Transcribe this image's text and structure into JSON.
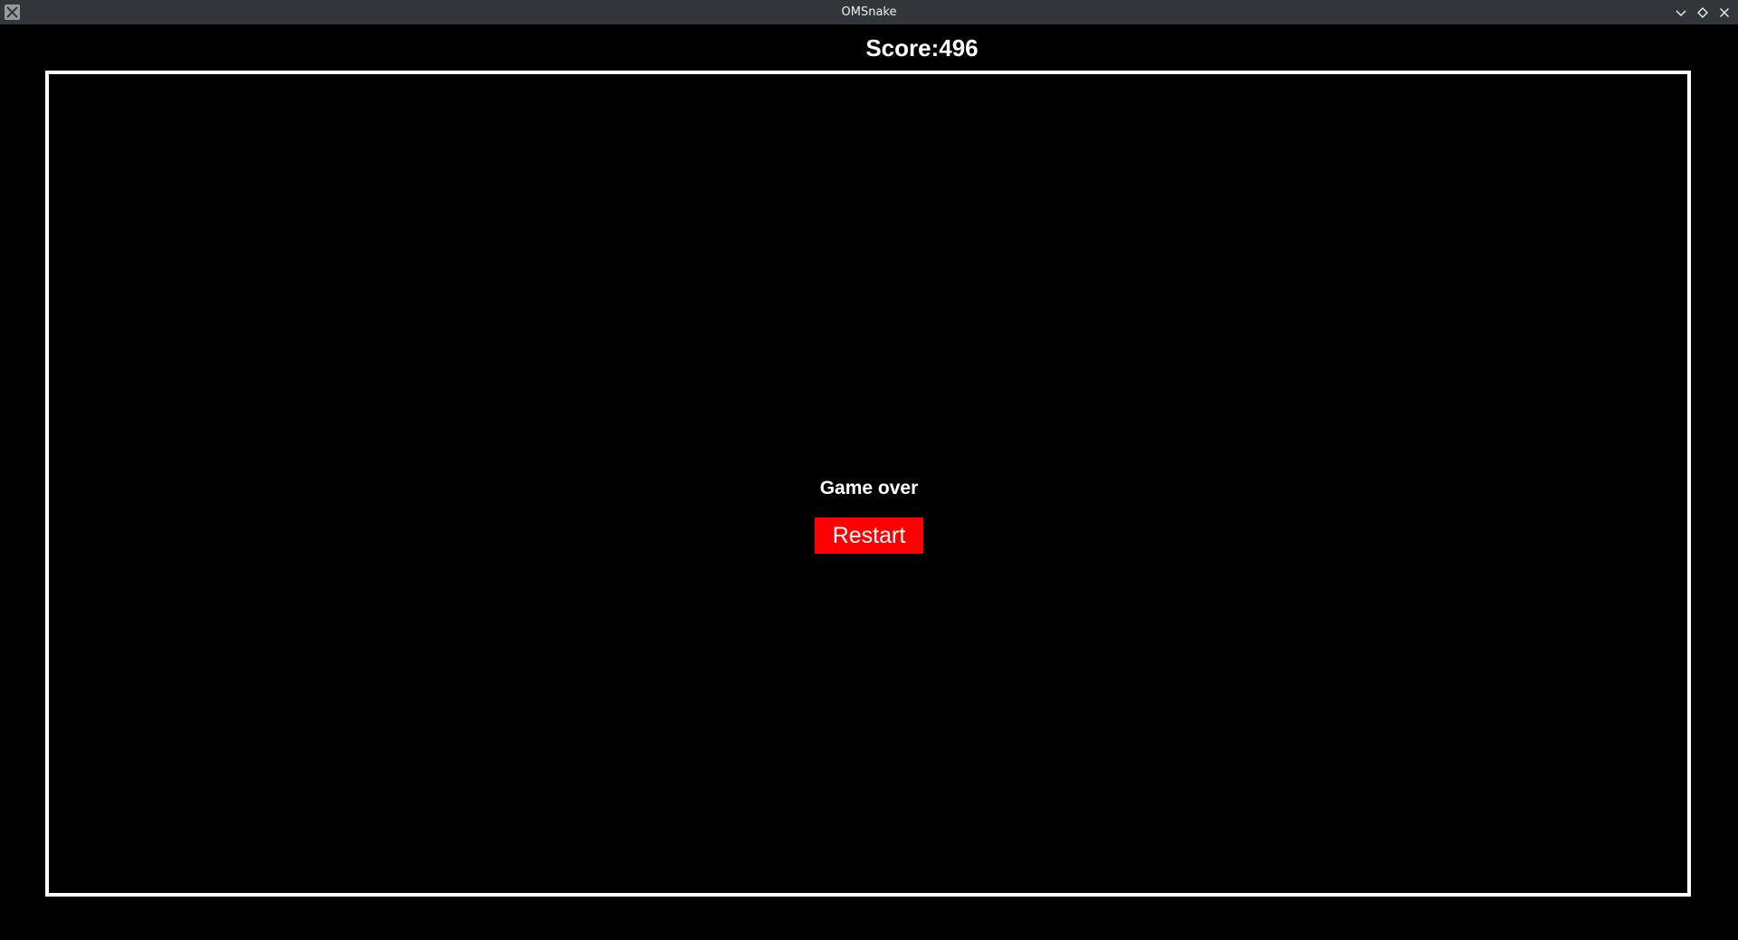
{
  "window": {
    "title": "OMSnake",
    "app_icon": "x11-icon",
    "controls": [
      "minimize-icon",
      "maximize-icon",
      "close-icon"
    ],
    "titlebar_color": "#31363b"
  },
  "game": {
    "score_label": "Score:496",
    "status_text": "Game over",
    "restart_label": "Restart",
    "board_border_color": "#ffffff",
    "restart_color": "#ff0000",
    "background_color": "#000000"
  }
}
